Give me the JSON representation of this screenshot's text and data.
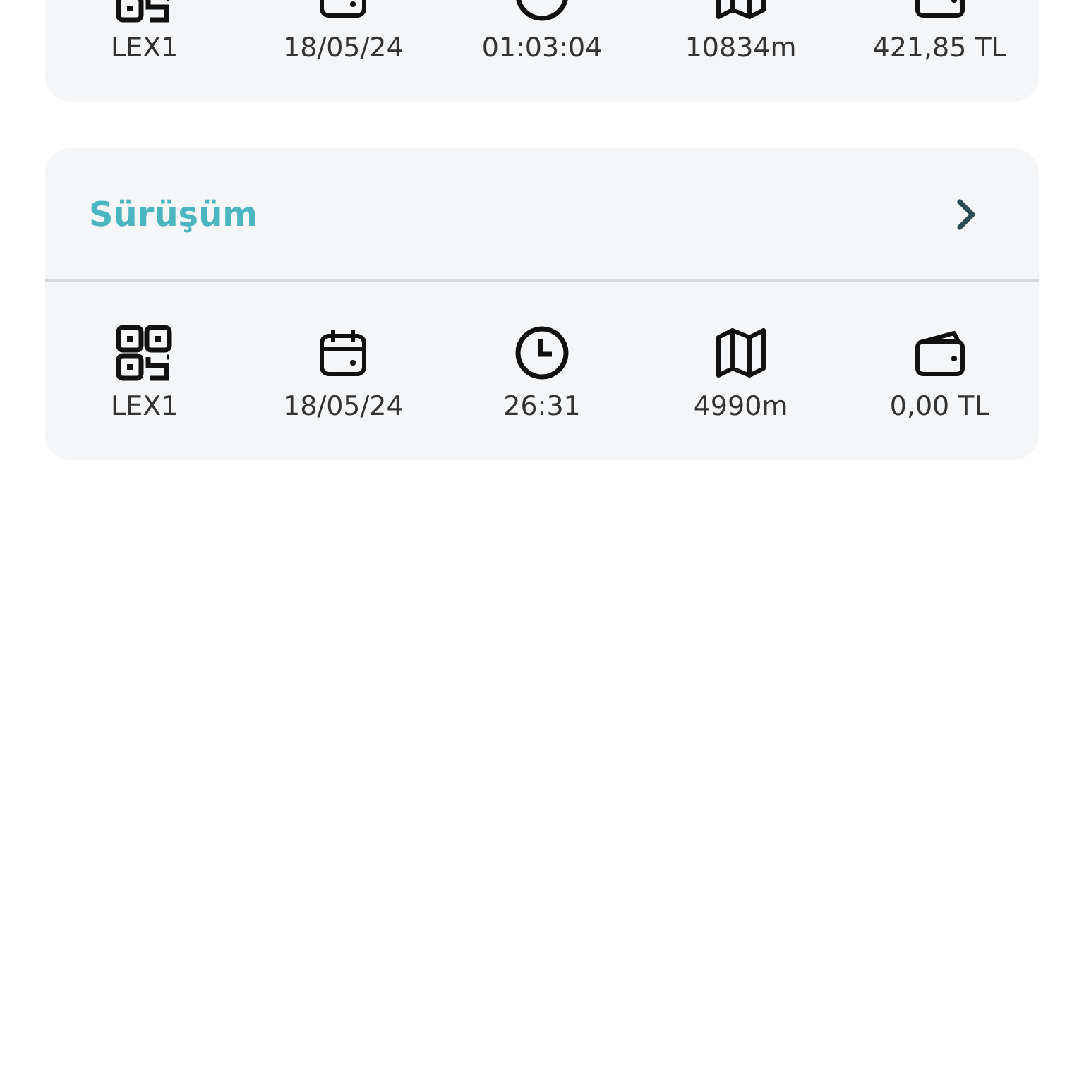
{
  "cards": [
    {
      "stats": [
        {
          "kind": "vehicle",
          "value": "LEX1"
        },
        {
          "kind": "date",
          "value": "18/05/24"
        },
        {
          "kind": "duration",
          "value": "01:03:04"
        },
        {
          "kind": "distance",
          "value": "10834m"
        },
        {
          "kind": "cost",
          "value": "421,85 TL"
        }
      ]
    },
    {
      "title": "Sürüşüm",
      "stats": [
        {
          "kind": "vehicle",
          "value": "LEX1"
        },
        {
          "kind": "date",
          "value": "18/05/24"
        },
        {
          "kind": "duration",
          "value": "26:31"
        },
        {
          "kind": "distance",
          "value": "4990m"
        },
        {
          "kind": "cost",
          "value": "0,00 TL"
        }
      ]
    }
  ]
}
